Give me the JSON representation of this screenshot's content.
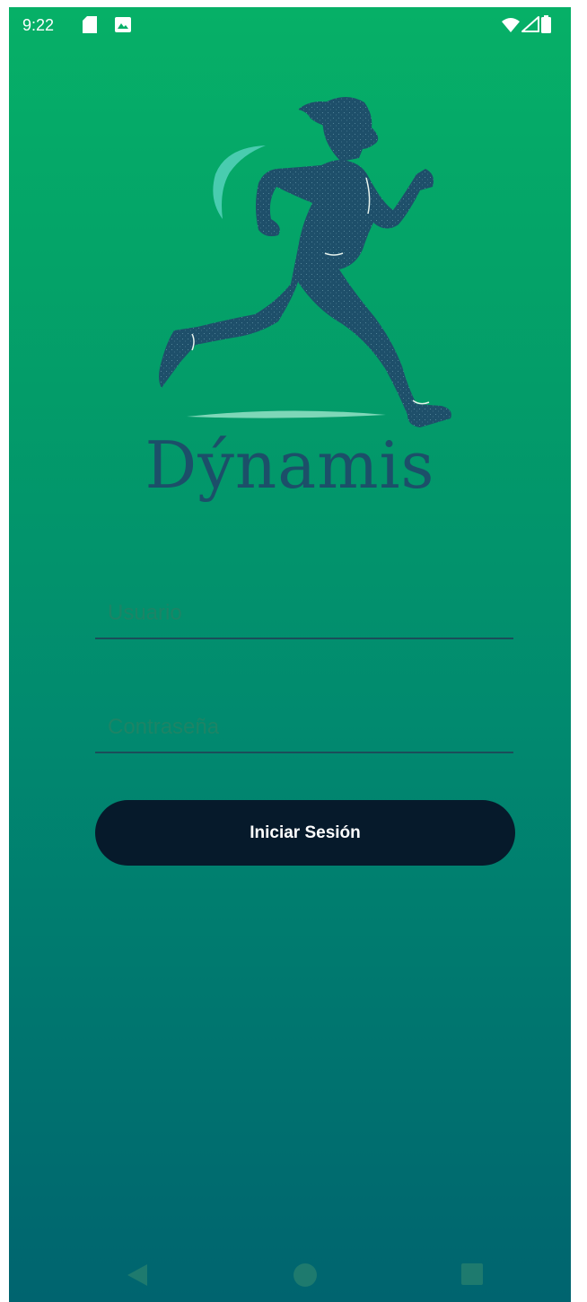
{
  "status_bar": {
    "time": "9:22",
    "icons": [
      "sd-card-icon",
      "photo-icon",
      "wifi-icon",
      "signal-icon",
      "battery-icon"
    ]
  },
  "app": {
    "name": "Dýnamis",
    "logo": "running-person-logo"
  },
  "login_form": {
    "username_placeholder": "Usuario",
    "username_value": "",
    "password_placeholder": "Contraseña",
    "password_value": "",
    "submit_label": "Iniciar Sesión"
  },
  "nav_bar": {
    "icons": [
      "back-icon",
      "home-icon",
      "recents-icon"
    ]
  },
  "colors": {
    "gradient_top": "#06b067",
    "gradient_bottom": "#00646f",
    "brand_text": "#1c4f69",
    "button_background": "#061a2b",
    "button_text": "#ffffff"
  }
}
